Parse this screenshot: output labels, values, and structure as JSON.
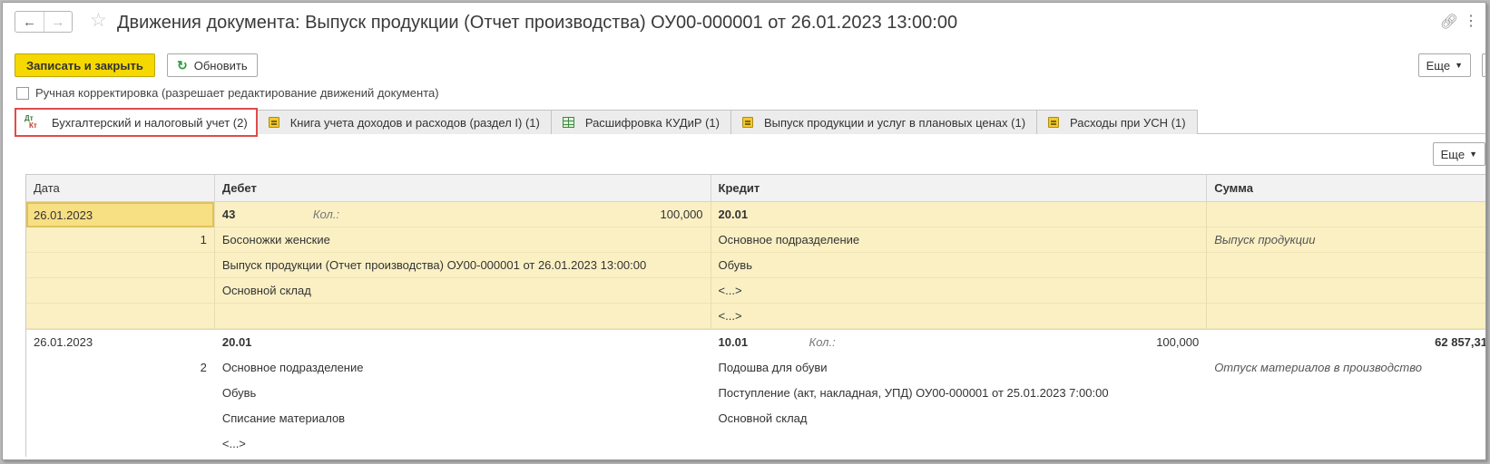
{
  "window": {
    "title": "Движения документа: Выпуск продукции (Отчет производства) ОУ00-000001 от 26.01.2023 13:00:00",
    "nav_back_icon": "arrow-left-icon",
    "nav_forward_icon": "arrow-right-icon",
    "favorite_icon": "star-icon",
    "link_icon": "link-icon",
    "menu_icon": "kebab-icon"
  },
  "toolbar": {
    "save_close_label": "Записать и закрыть",
    "refresh_label": "Обновить",
    "more_label": "Еще"
  },
  "manual_adjust": {
    "label": "Ручная корректировка (разрешает редактирование движений документа)",
    "checked": false
  },
  "tabs": [
    {
      "label": "Бухгалтерский и налоговый учет (2)",
      "icon": "dt-kt-icon",
      "active": true
    },
    {
      "label": "Книга учета доходов и расходов (раздел I) (1)",
      "icon": "register-icon",
      "active": false
    },
    {
      "label": "Расшифровка КУДиР (1)",
      "icon": "table-icon",
      "active": false
    },
    {
      "label": "Выпуск продукции и услуг в плановых ценах (1)",
      "icon": "register-icon",
      "active": false
    },
    {
      "label": "Расходы при УСН (1)",
      "icon": "register-icon",
      "active": false
    }
  ],
  "table": {
    "more_label": "Еще",
    "columns": [
      "Дата",
      "Дебет",
      "Кредит",
      "Сумма"
    ],
    "rows": [
      {
        "date": "26.01.2023",
        "number": "1",
        "debet": {
          "account": "43",
          "qty_label": "Кол.:",
          "qty": "100,000",
          "subconto": [
            "Босоножки женские",
            "Выпуск продукции (Отчет производства) ОУ00-000001 от 26.01.2023 13:00:00",
            "Основной склад"
          ]
        },
        "kredit": {
          "account": "20.01",
          "subconto": [
            "Основное подразделение",
            "Обувь",
            "<...>",
            "<...>"
          ]
        },
        "sum": "",
        "content": "Выпуск продукции"
      },
      {
        "date": "26.01.2023",
        "number": "2",
        "debet": {
          "account": "20.01",
          "subconto": [
            "Основное подразделение",
            "Обувь",
            "Списание материалов",
            "<...>"
          ]
        },
        "kredit": {
          "account": "10.01",
          "qty_label": "Кол.:",
          "qty": "100,000",
          "subconto": [
            "Подошва для обуви",
            "Поступление (акт, накладная, УПД) ОУ00-000001 от 25.01.2023 7:00:00",
            "Основной склад"
          ]
        },
        "sum": "62 857,31",
        "content": "Отпуск материалов в производство"
      }
    ]
  }
}
